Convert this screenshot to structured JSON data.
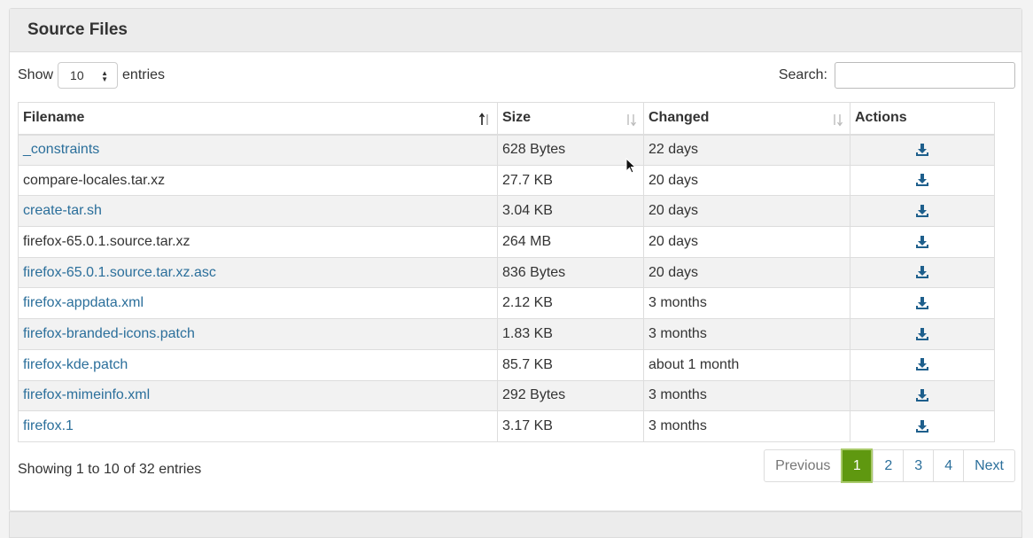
{
  "panel": {
    "title": "Source Files"
  },
  "length": {
    "show": "Show",
    "value": "10",
    "entries": "entries"
  },
  "search": {
    "label": "Search:",
    "value": ""
  },
  "table": {
    "columns": [
      "Filename",
      "Size",
      "Changed",
      "Actions"
    ],
    "rows": [
      {
        "name": "_constraints",
        "size": "628 Bytes",
        "changed": "22 days",
        "link": true
      },
      {
        "name": "compare-locales.tar.xz",
        "size": "27.7 KB",
        "changed": "20 days",
        "link": false
      },
      {
        "name": "create-tar.sh",
        "size": "3.04 KB",
        "changed": "20 days",
        "link": true
      },
      {
        "name": "firefox-65.0.1.source.tar.xz",
        "size": "264 MB",
        "changed": "20 days",
        "link": false
      },
      {
        "name": "firefox-65.0.1.source.tar.xz.asc",
        "size": "836 Bytes",
        "changed": "20 days",
        "link": true
      },
      {
        "name": "firefox-appdata.xml",
        "size": "2.12 KB",
        "changed": "3 months",
        "link": true
      },
      {
        "name": "firefox-branded-icons.patch",
        "size": "1.83 KB",
        "changed": "3 months",
        "link": true
      },
      {
        "name": "firefox-kde.patch",
        "size": "85.7 KB",
        "changed": "about 1 month",
        "link": true
      },
      {
        "name": "firefox-mimeinfo.xml",
        "size": "292 Bytes",
        "changed": "3 months",
        "link": true
      },
      {
        "name": "firefox.1",
        "size": "3.17 KB",
        "changed": "3 months",
        "link": true
      }
    ]
  },
  "footer": {
    "info": "Showing 1 to 10 of 32 entries"
  },
  "pagination": {
    "previous": "Previous",
    "pages": [
      "1",
      "2",
      "3",
      "4"
    ],
    "active": "1",
    "next": "Next"
  },
  "colors": {
    "link": "#2b6f9b",
    "active_page": "#5f9810",
    "download_icon": "#1e5f8c"
  }
}
